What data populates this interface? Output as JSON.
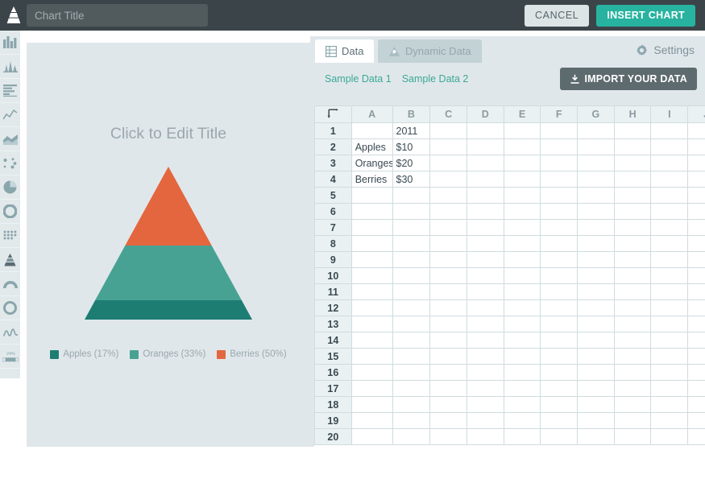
{
  "topbar": {
    "logo_icon": "pyramid-chart-icon",
    "title_input": {
      "value": "",
      "placeholder": "Chart Title"
    },
    "cancel_label": "CANCEL",
    "insert_label": "INSERT CHART"
  },
  "sidebar": {
    "items": [
      {
        "icon": "bar-chart-icon",
        "name": "column-chart",
        "active": false
      },
      {
        "icon": "histogram-icon",
        "name": "histogram-chart",
        "active": false
      },
      {
        "icon": "horizontal-bar-icon",
        "name": "bar-chart",
        "active": false
      },
      {
        "icon": "line-chart-icon",
        "name": "line-chart",
        "active": false
      },
      {
        "icon": "area-chart-icon",
        "name": "area-chart",
        "active": false
      },
      {
        "icon": "scatter-plot-icon",
        "name": "scatter-chart",
        "active": false
      },
      {
        "icon": "pie-chart-icon",
        "name": "pie-chart",
        "active": false
      },
      {
        "icon": "donut-chart-icon",
        "name": "donut-chart",
        "active": false
      },
      {
        "icon": "dot-matrix-icon",
        "name": "dot-matrix-chart",
        "active": false
      },
      {
        "icon": "pyramid-chart-icon",
        "name": "pyramid-chart",
        "active": true
      },
      {
        "icon": "gauge-chart-icon",
        "name": "gauge-chart",
        "active": false
      },
      {
        "icon": "ring-chart-icon",
        "name": "ring-chart",
        "active": false
      },
      {
        "icon": "sparkline-icon",
        "name": "sparkline-chart",
        "active": false
      },
      {
        "icon": "progress-bar-icon",
        "name": "progress-chart",
        "active": false,
        "badge": "24%"
      }
    ]
  },
  "chart_panel": {
    "title_placeholder": "Click to Edit Title"
  },
  "data_panel": {
    "tabs": [
      {
        "label": "Data",
        "icon": "table-grid-icon",
        "active": true,
        "name": "tab-data"
      },
      {
        "label": "Dynamic Data",
        "icon": "drive-icon",
        "active": false,
        "name": "tab-dynamic-data"
      }
    ],
    "settings_label": "Settings",
    "settings_icon": "gear-icon",
    "sample_links": [
      "Sample Data 1",
      "Sample Data 2"
    ],
    "import_label": "IMPORT YOUR DATA",
    "import_icon": "download-icon",
    "corner_icon": "wrap-arrow-icon",
    "columns": [
      "A",
      "B",
      "C",
      "D",
      "E",
      "F",
      "G",
      "H",
      "I",
      "J"
    ],
    "row_count": 20,
    "cells": {
      "1": {
        "B": "2011"
      },
      "2": {
        "A": "Apples",
        "B": "$10"
      },
      "3": {
        "A": "Oranges",
        "B": "$20"
      },
      "4": {
        "A": "Berries",
        "B": "$30"
      }
    }
  },
  "chart_data": {
    "type": "pie",
    "subtype": "pyramid",
    "title": "Click to Edit Title",
    "categories": [
      "Apples",
      "Oranges",
      "Berries"
    ],
    "values": [
      10,
      20,
      30
    ],
    "value_labels": [
      "$10",
      "$20",
      "$30"
    ],
    "percents": [
      17,
      33,
      50
    ],
    "series_header": "2011",
    "legend": [
      {
        "label": "Apples (17%)",
        "color": "#1d7d73"
      },
      {
        "label": "Oranges (33%)",
        "color": "#47a294"
      },
      {
        "label": "Berries (50%)",
        "color": "#e4663f"
      }
    ],
    "legend_position": "bottom",
    "grid": false,
    "xlabel": "",
    "ylabel": ""
  },
  "colors": {
    "brand_teal": "#27b3a0",
    "topbar_bg": "#3b4549",
    "panel_bg": "#e0e7ea",
    "link_teal": "#3aa996",
    "slice_apples": "#1d7d73",
    "slice_oranges": "#47a294",
    "slice_berries": "#e4663f"
  }
}
